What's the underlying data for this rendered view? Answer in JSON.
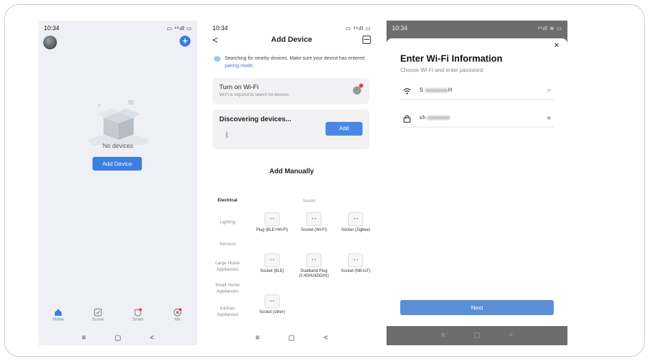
{
  "screen1": {
    "time": "10:34",
    "status_right": "▭ ⁴⁵ıll ▭",
    "empty_text": "No devices",
    "add_button": "Add Device",
    "tabs": [
      {
        "label": "Home",
        "icon": "home-icon",
        "active": true
      },
      {
        "label": "Scene",
        "icon": "scene-icon",
        "active": false
      },
      {
        "label": "Smart",
        "icon": "smart-icon",
        "active": false
      },
      {
        "label": "Me",
        "icon": "me-icon",
        "active": false
      }
    ],
    "nav": [
      "≡",
      "▢",
      "<"
    ]
  },
  "screen2": {
    "time": "10:34",
    "status_right": "▭ ⁴⁵ıll ▭",
    "back": "<",
    "title": "Add Device",
    "search_note": "Searching for nearby devices. Make sure your device has entered ",
    "search_link": "pairing mode",
    "search_end": ".",
    "wifi_title": "Turn on Wi-Fi",
    "wifi_sub": "Wi-Fi is required to search for devices.",
    "discover_title": "Discovering devices...",
    "discover_button": "Add",
    "manual_title": "Add Manually",
    "categories": [
      {
        "label": "Electrical",
        "active": true
      },
      {
        "label": "Lighting",
        "active": false
      },
      {
        "label": "Sensors",
        "active": false
      },
      {
        "label": "Large Home Appliances",
        "active": false
      },
      {
        "label": "Small Home Appliances",
        "active": false
      },
      {
        "label": "Kitchen Appliances",
        "active": false
      }
    ],
    "sub_title": "Socket",
    "items": [
      {
        "label": "Plug (BLE+Wi-Fi)"
      },
      {
        "label": "Socket (Wi-Fi)"
      },
      {
        "label": "Socket (Zigbee)"
      },
      {
        "label": "Socket (BLE)"
      },
      {
        "label": "Dualband Plug (2.4GHz&5GHz)"
      },
      {
        "label": "Socket (NB-IoT)"
      },
      {
        "label": "Socket (other)"
      }
    ],
    "nav": [
      "≡",
      "▢",
      "<"
    ]
  },
  "screen3": {
    "time": "10:34",
    "status_right": "⁴⁵ıll ≋ ▭",
    "close": "×",
    "title": "Enter Wi-Fi Information",
    "subtitle": "Choose Wi-Fi and enter password",
    "ssid_prefix": "S",
    "ssid_suffix": "H",
    "password_prefix": "sh",
    "swap_icon": "⇄",
    "eye_icon": "◉",
    "next": "Next",
    "nav": [
      "≡",
      "▢",
      "<"
    ]
  }
}
